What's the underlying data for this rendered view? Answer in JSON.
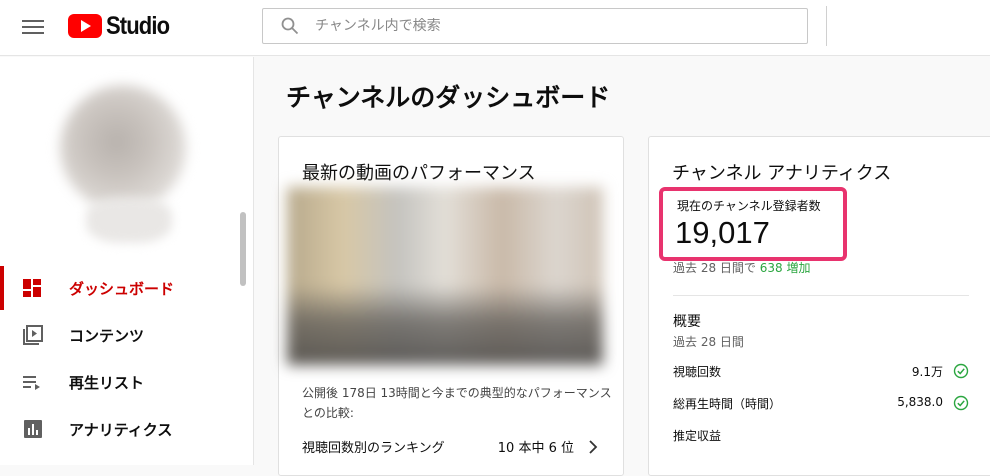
{
  "header": {
    "logo_text": "Studio",
    "search_placeholder": "チャンネル内で検索"
  },
  "sidebar": {
    "items": [
      {
        "label": "ダッシュボード",
        "icon": "dashboard-icon",
        "active": true
      },
      {
        "label": "コンテンツ",
        "icon": "content-icon",
        "active": false
      },
      {
        "label": "再生リスト",
        "icon": "playlist-icon",
        "active": false
      },
      {
        "label": "アナリティクス",
        "icon": "analytics-icon",
        "active": false
      }
    ]
  },
  "main": {
    "page_title": "チャンネルのダッシュボード",
    "latest_video": {
      "title": "最新の動画のパフォーマンス",
      "note": "公開後 178日 13時間と今までの典型的なパフォーマンスとの比較:",
      "rank_label": "視聴回数別のランキング",
      "rank_value": "10 本中 6 位"
    },
    "analytics": {
      "title": "チャンネル アナリティクス",
      "subscribers_label": "現在のチャンネル登録者数",
      "subscribers_value": "19,017",
      "change_prefix": "過去 28 日間で",
      "change_value": "638 増加",
      "summary_title": "概要",
      "summary_period": "過去 28 日間",
      "metrics": [
        {
          "label": "視聴回数",
          "value": "9.1万"
        },
        {
          "label": "総再生時間（時間）",
          "value": "5,838.0"
        },
        {
          "label": "推定収益",
          "value": ""
        }
      ]
    }
  },
  "colors": {
    "accent_red": "#cc0000",
    "highlight_pink": "#e8336e",
    "positive_green": "#2ba640"
  }
}
